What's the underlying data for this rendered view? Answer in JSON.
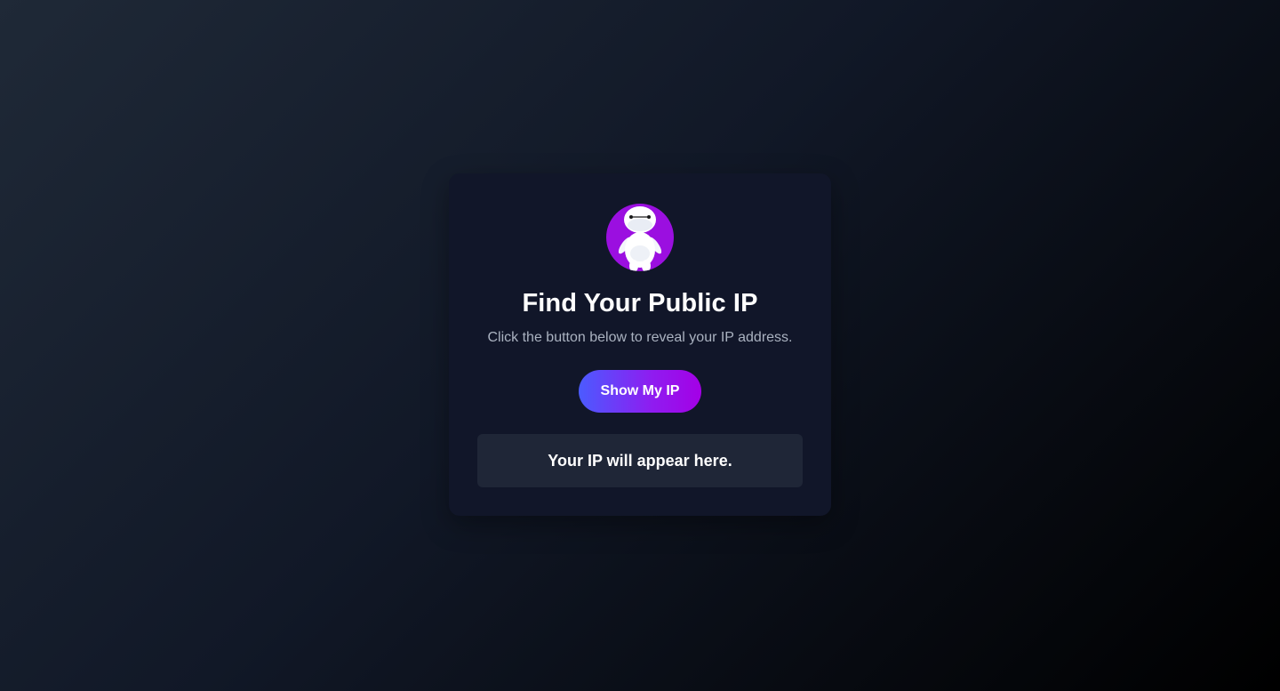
{
  "card": {
    "avatar_icon": "robot-mascot-icon",
    "title": "Find Your Public IP",
    "subtitle": "Click the button below to reveal your IP address.",
    "button_label": "Show My IP",
    "result_text": "Your IP will appear here."
  },
  "colors": {
    "avatar_background": "#9b0fe0",
    "button_gradient_start": "#4b5bff",
    "button_gradient_end": "#a400e6",
    "card_background": "#111629",
    "result_background": "#1f2637"
  }
}
